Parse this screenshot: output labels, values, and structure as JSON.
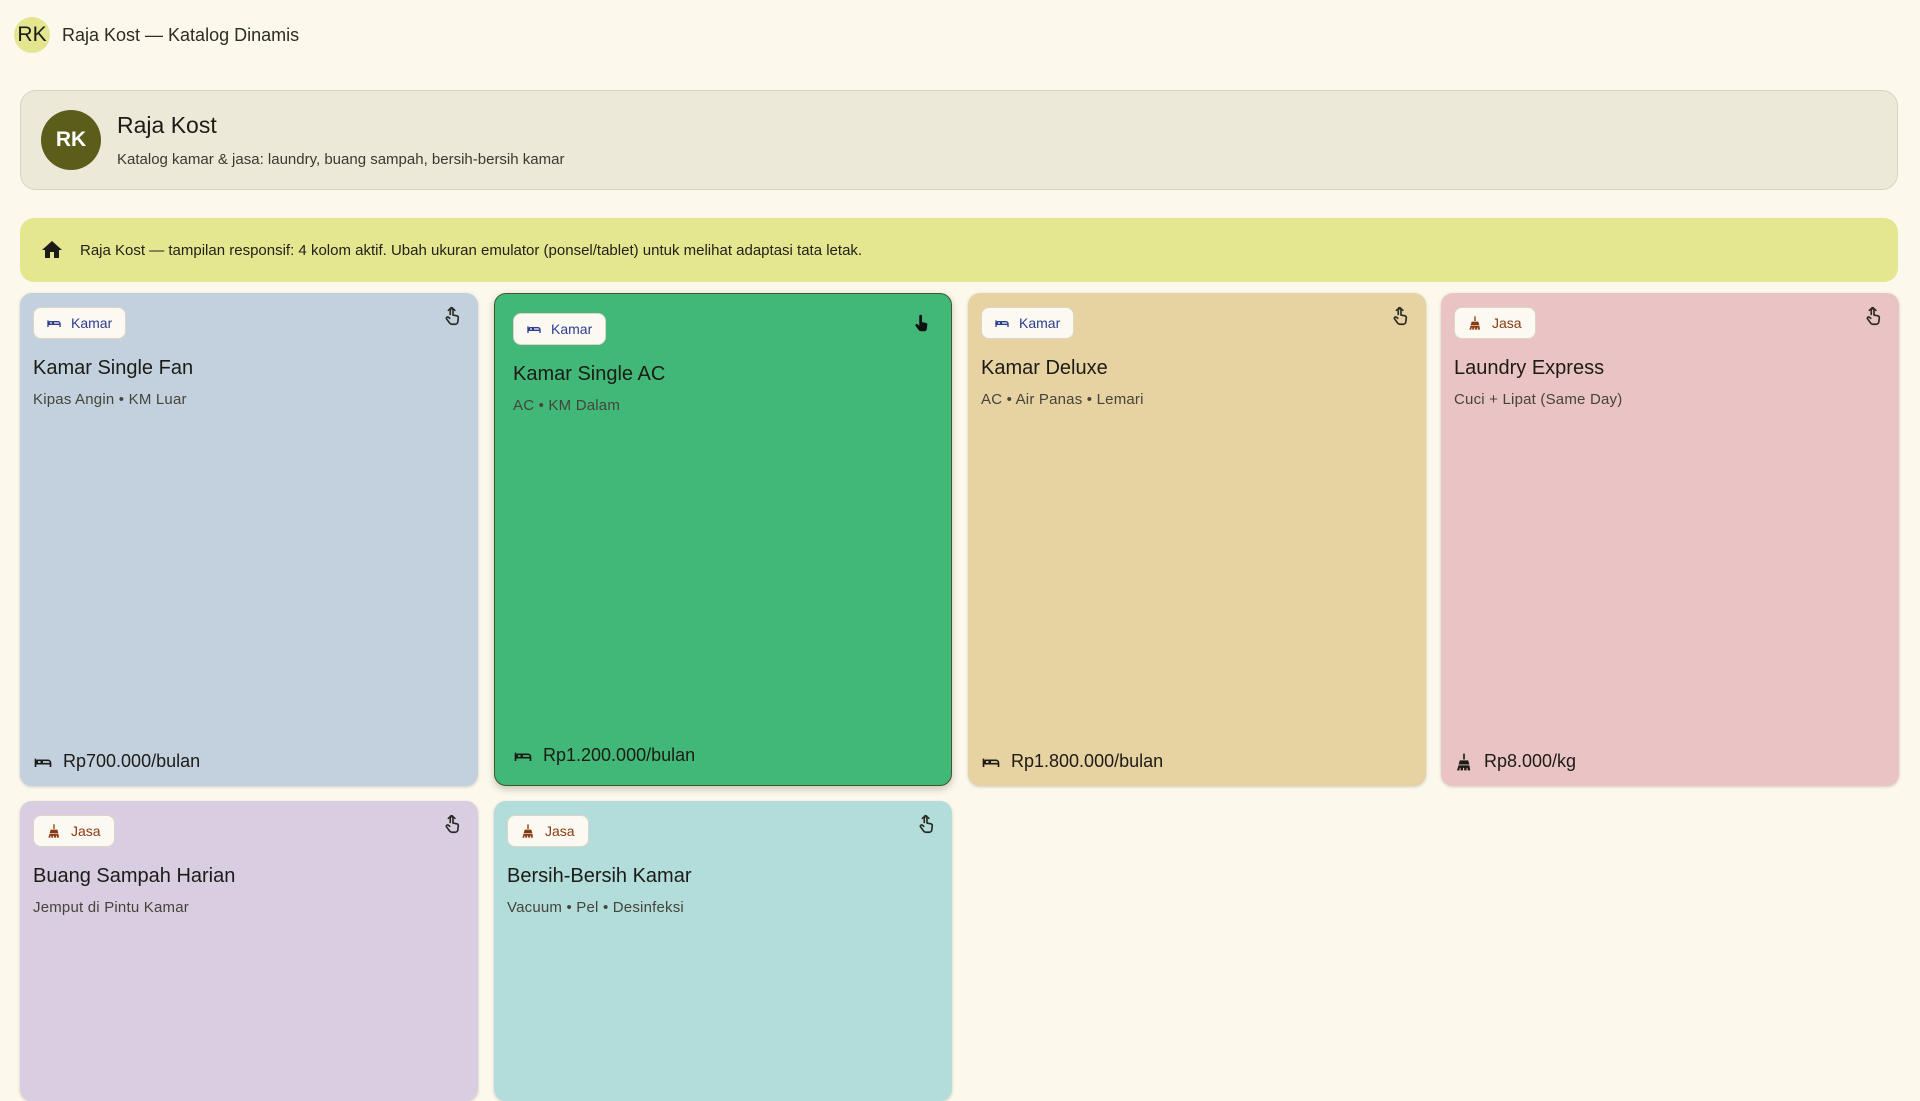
{
  "appbar": {
    "avatar": "RK",
    "title": "Raja Kost — Katalog Dinamis"
  },
  "header": {
    "logo": "RK",
    "name": "Raja Kost",
    "subtitle": "Katalog kamar & jasa: laundry, buang sampah, bersih-bersih kamar"
  },
  "banner": {
    "icon": "home-icon",
    "text": "Raja Kost — tampilan responsif: 4 kolom aktif. Ubah ukuran emulator (ponsel/tablet) untuk melihat adaptasi tata letak."
  },
  "cards": [
    {
      "chip": "Kamar",
      "chip_icon": "bed-icon",
      "name": "Kamar Single Fan",
      "desc": "Kipas Angin • KM Luar",
      "price": "Rp700.000/bulan",
      "price_icon": "bed-icon",
      "color": "#c3d1df",
      "selected": false
    },
    {
      "chip": "Kamar",
      "chip_icon": "bed-icon",
      "name": "Kamar Single AC",
      "desc": "AC • KM Dalam",
      "price": "Rp1.200.000/bulan",
      "price_icon": "bed-icon",
      "color": "#41b878",
      "selected": true
    },
    {
      "chip": "Kamar",
      "chip_icon": "bed-icon",
      "name": "Kamar Deluxe",
      "desc": "AC • Air Panas • Lemari",
      "price": "Rp1.800.000/bulan",
      "price_icon": "bed-icon",
      "color": "#e7d2a1",
      "selected": false
    },
    {
      "chip": "Jasa",
      "chip_icon": "cleaning-icon",
      "name": "Laundry Express",
      "desc": "Cuci + Lipat (Same Day)",
      "price": "Rp8.000/kg",
      "price_icon": "cleaning-icon",
      "color": "#eac4c4",
      "selected": false
    },
    {
      "chip": "Jasa",
      "chip_icon": "cleaning-icon",
      "name": "Buang Sampah Harian",
      "desc": "Jemput di Pintu Kamar",
      "price": "",
      "price_icon": "cleaning-icon",
      "color": "#d9cde2",
      "selected": false
    },
    {
      "chip": "Jasa",
      "chip_icon": "cleaning-icon",
      "name": "Bersih-Bersih Kamar",
      "desc": "Vacuum • Pel • Desinfeksi",
      "price": "",
      "price_icon": "cleaning-icon",
      "color": "#b3dddb",
      "selected": false
    }
  ]
}
